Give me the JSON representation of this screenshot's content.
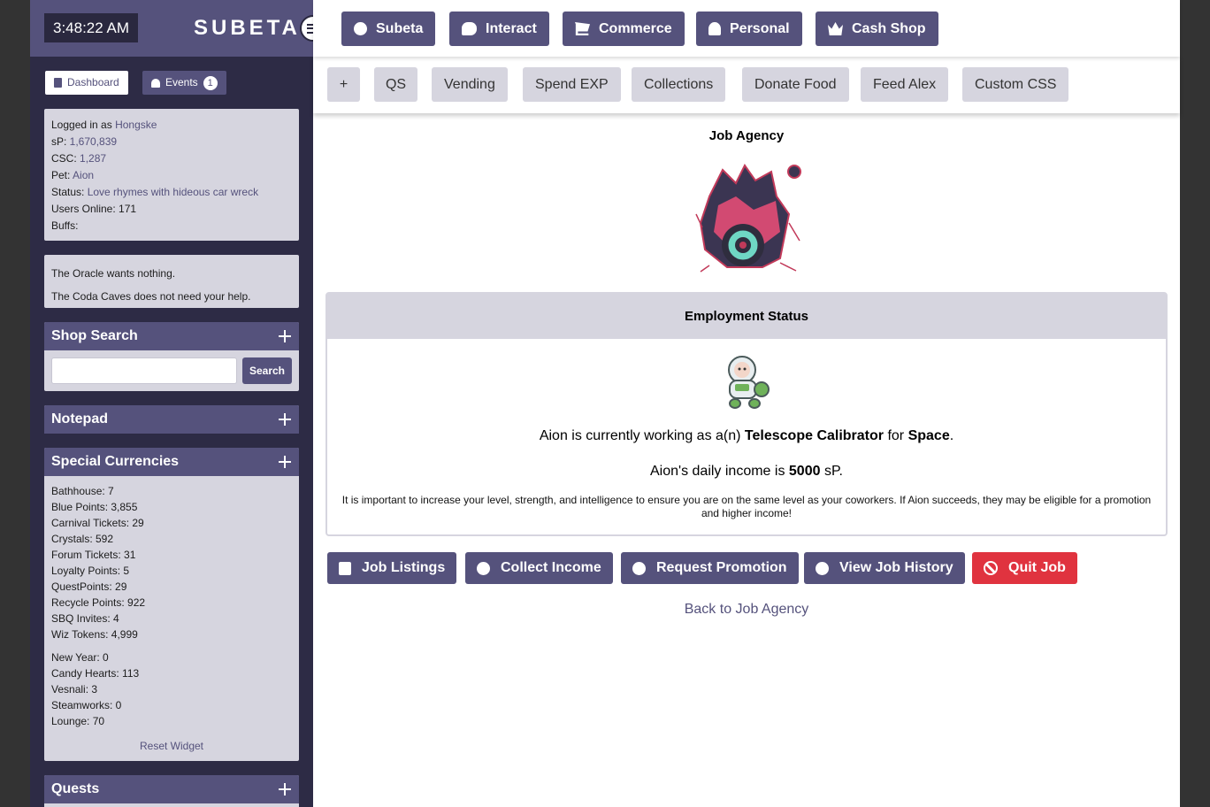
{
  "header": {
    "clock": "3:48:22 AM",
    "logo": "SUBETA"
  },
  "sidebar_tabs": {
    "dashboard": "Dashboard",
    "events": "Events",
    "events_count": "1"
  },
  "user_info": {
    "logged_in_label": "Logged in as ",
    "username": "Hongske",
    "sp_label": "sP: ",
    "sp_value": "1,670,839",
    "csc_label": "CSC: ",
    "csc_value": "1,287",
    "pet_label": "Pet: ",
    "pet_value": "Aion",
    "status_label": "Status: ",
    "status_value": "Love rhymes with hideous car wreck",
    "users_online": "Users Online: 171",
    "buffs": "Buffs:"
  },
  "oracle": {
    "line1": "The Oracle wants nothing.",
    "line2": "The Coda Caves does not need your help."
  },
  "shop_search": {
    "title": "Shop Search",
    "placeholder": "",
    "button": "Search"
  },
  "notepad": {
    "title": "Notepad"
  },
  "currencies": {
    "title": "Special Currencies",
    "group1": [
      "Bathhouse: 7",
      "Blue Points: 3,855",
      "Carnival Tickets: 29",
      "Crystals: 592",
      "Forum Tickets: 31",
      "Loyalty Points: 5",
      "QuestPoints: 29",
      "Recycle Points: 922",
      "SBQ Invites: 4",
      "Wiz Tokens: 4,999"
    ],
    "group2": [
      "New Year: 0",
      "Candy Hearts: 113",
      "Vesnali: 3",
      "Steamworks: 0",
      "Lounge: 70"
    ],
    "reset": "Reset Widget"
  },
  "quests": {
    "title": "Quests"
  },
  "topnav": {
    "items": [
      "Subeta",
      "Interact",
      "Commerce",
      "Personal",
      "Cash Shop"
    ],
    "icons": [
      "compass-icon",
      "chat-icon",
      "cart-icon",
      "user-icon",
      "crown-icon"
    ]
  },
  "subnav": {
    "items": [
      "+",
      "QS",
      "Vending",
      "Spend EXP",
      "Collections",
      "Donate Food",
      "Feed Alex",
      "Custom CSS"
    ]
  },
  "page": {
    "heading": "Job Agency",
    "status_title": "Employment Status",
    "working_prefix": "Aion is currently working as a(n) ",
    "job_title": "Telescope Calibrator",
    "working_mid": " for ",
    "employer": "Space",
    "working_suffix": ".",
    "income_prefix": "Aion's daily income is ",
    "income_value": "5000",
    "income_suffix": " sP.",
    "note": "It is important to increase your level, strength, and intelligence to ensure you are on the same level as your coworkers. If Aion succeeds, they may be eligible for a promotion and higher income!",
    "back_link": "Back to Job Agency"
  },
  "actions": {
    "job_listings": "Job Listings",
    "collect_income": "Collect Income",
    "request_promotion": "Request Promotion",
    "view_job_history": "View Job History",
    "quit_job": "Quit Job"
  },
  "colors": {
    "brand": "#55527c",
    "sidebar_bg": "#2d2b45",
    "panel_bg": "#d6d5df",
    "danger": "#e0333f"
  }
}
